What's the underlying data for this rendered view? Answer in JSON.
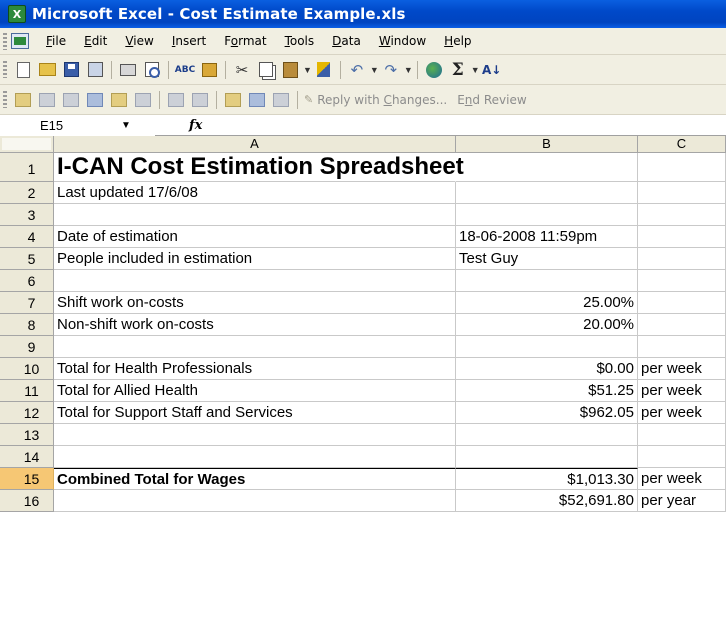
{
  "window": {
    "title": "Microsoft Excel - Cost Estimate Example.xls",
    "app_icon_glyph": "X"
  },
  "menu": [
    {
      "label": "File",
      "u": "F",
      "rest": "ile"
    },
    {
      "label": "Edit",
      "u": "E",
      "rest": "dit"
    },
    {
      "label": "View",
      "u": "V",
      "rest": "iew"
    },
    {
      "label": "Insert",
      "u": "I",
      "rest": "nsert"
    },
    {
      "label": "Format",
      "pre": "F",
      "u": "o",
      "rest": "rmat"
    },
    {
      "label": "Tools",
      "u": "T",
      "rest": "ools"
    },
    {
      "label": "Data",
      "u": "D",
      "rest": "ata"
    },
    {
      "label": "Window",
      "u": "W",
      "rest": "indow"
    },
    {
      "label": "Help",
      "u": "H",
      "rest": "elp"
    }
  ],
  "toolbar": {
    "reply_with_changes": {
      "pre": "Reply with ",
      "u": "C",
      "rest": "hanges..."
    },
    "end_review": {
      "pre": "E",
      "u": "n",
      "rest": "d Review"
    },
    "spell_glyph": "ABC",
    "sigma_glyph": "Σ",
    "sort_glyph": "A↓"
  },
  "formula_bar": {
    "name_box": "E15",
    "fx": "fx"
  },
  "columns": [
    "A",
    "B",
    "C"
  ],
  "rows": [
    {
      "n": "1",
      "a": "I-CAN Cost Estimation Spreadsheet",
      "b": "",
      "c": ""
    },
    {
      "n": "2",
      "a": "Last updated 17/6/08",
      "b": "",
      "c": ""
    },
    {
      "n": "3",
      "a": "",
      "b": "",
      "c": ""
    },
    {
      "n": "4",
      "a": "Date of estimation",
      "b": "18-06-2008 11:59pm",
      "c": ""
    },
    {
      "n": "5",
      "a": "People included in estimation",
      "b": "Test Guy",
      "c": ""
    },
    {
      "n": "6",
      "a": "",
      "b": "",
      "c": ""
    },
    {
      "n": "7",
      "a": "Shift work on-costs",
      "b": "25.00%",
      "c": ""
    },
    {
      "n": "8",
      "a": "Non-shift work on-costs",
      "b": "20.00%",
      "c": ""
    },
    {
      "n": "9",
      "a": "",
      "b": "",
      "c": ""
    },
    {
      "n": "10",
      "a": "Total for Health Professionals",
      "b": "$0.00",
      "c": "per week"
    },
    {
      "n": "11",
      "a": "Total for Allied Health",
      "b": "$51.25",
      "c": "per week"
    },
    {
      "n": "12",
      "a": "Total for Support Staff and Services",
      "b": "$962.05",
      "c": "per week"
    },
    {
      "n": "13",
      "a": "",
      "b": "",
      "c": ""
    },
    {
      "n": "14",
      "a": "",
      "b": "",
      "c": ""
    },
    {
      "n": "15",
      "a": "Combined Total for Wages",
      "b": "$1,013.30",
      "c": "per week"
    },
    {
      "n": "16",
      "a": "",
      "b": "$52,691.80",
      "c": "per year"
    }
  ]
}
